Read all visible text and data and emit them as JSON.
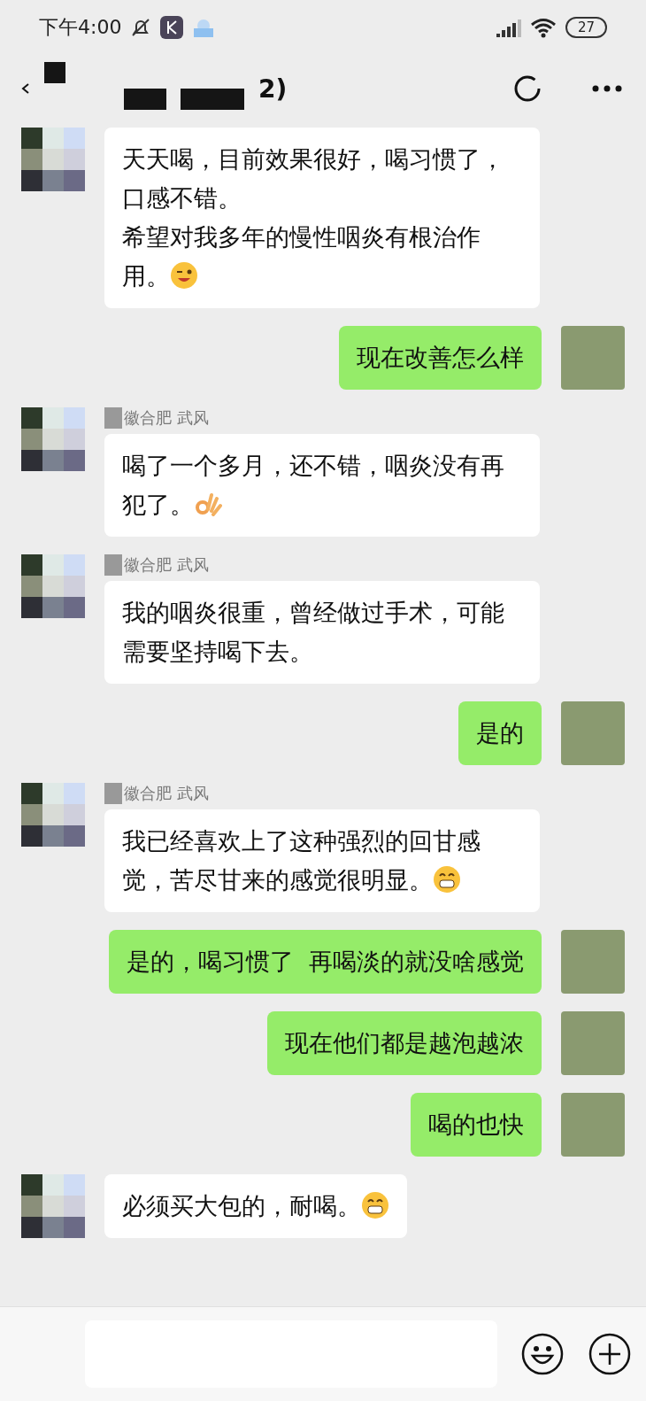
{
  "status_bar": {
    "time": "下午4:00",
    "battery": "27"
  },
  "header": {
    "title": "2)"
  },
  "messages": [
    {
      "kind": "received",
      "text": [
        "天天喝，目前效果很好，喝习惯了，口感不错。",
        "希望对我多年的慢性咽炎有根治作用。"
      ],
      "emoji": {
        "kind": "wink"
      }
    },
    {
      "kind": "sent",
      "text": [
        "现在改善怎么样"
      ]
    },
    {
      "kind": "received",
      "sender": "徽合肥 武风",
      "text": [
        "喝了一个多月，还不错，咽炎没有再犯了。"
      ],
      "emoji": {
        "kind": "ok"
      }
    },
    {
      "kind": "received",
      "sender": "徽合肥 武风",
      "text": [
        "我的咽炎很重，曾经做过手术，可能需要坚持喝下去。"
      ]
    },
    {
      "kind": "sent",
      "text": [
        "是的"
      ]
    },
    {
      "kind": "received",
      "sender": "徽合肥 武风",
      "text": [
        "我已经喜欢上了这种强烈的回甘感觉，苦尽甘来的感觉很明显。"
      ],
      "emoji": {
        "kind": "grin"
      }
    },
    {
      "kind": "sent",
      "text": [
        "是的，喝习惯了  再喝淡的就没啥感觉"
      ]
    },
    {
      "kind": "sent",
      "text": [
        "现在他们都是越泡越浓"
      ]
    },
    {
      "kind": "sent",
      "text": [
        "喝的也快"
      ]
    },
    {
      "kind": "received",
      "text": [
        "必须买大包的，耐喝。"
      ],
      "emoji": {
        "kind": "grin"
      }
    }
  ]
}
